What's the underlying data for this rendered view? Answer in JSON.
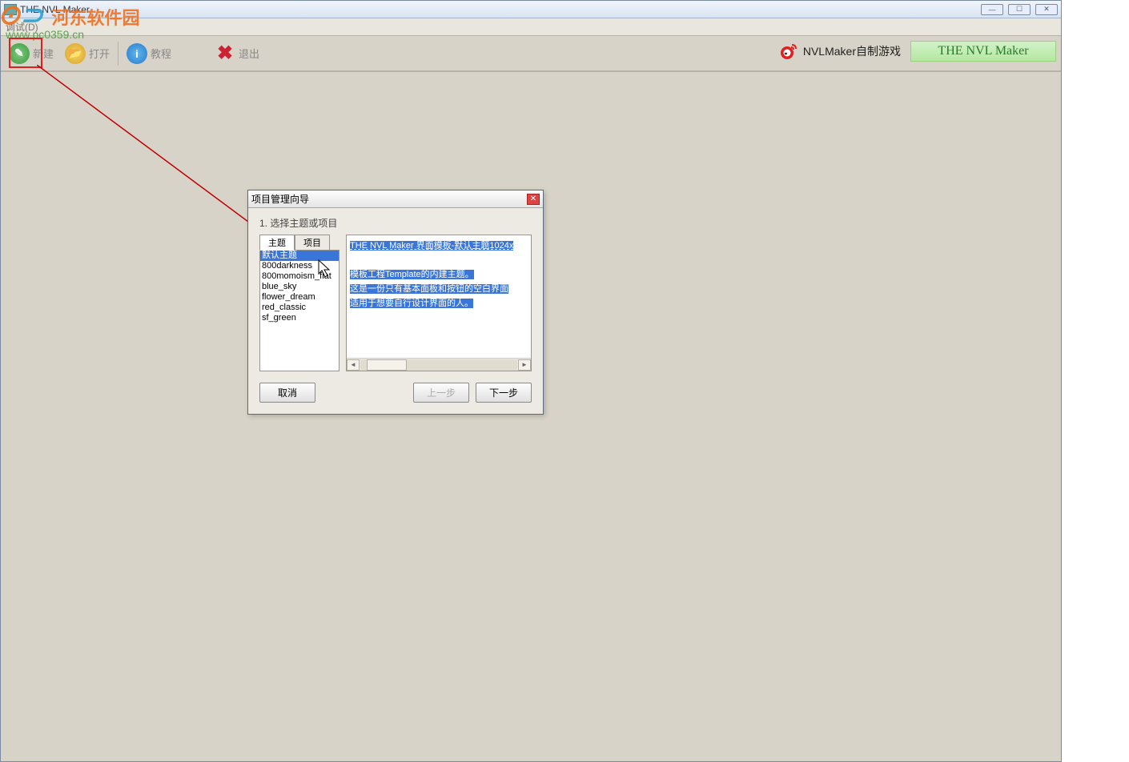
{
  "window": {
    "title": "THE NVL Maker"
  },
  "menu": {
    "debug": "调试(D)"
  },
  "toolbar": {
    "new": {
      "label": "新建"
    },
    "open": {
      "label": "打开"
    },
    "tutorial": {
      "label": "教程"
    },
    "exit": {
      "label": "退出"
    }
  },
  "brand": {
    "weibo": "NVLMaker自制游戏",
    "banner": "THE NVL Maker"
  },
  "watermark": {
    "logo_text": "河东软件园",
    "url": "www.pc0359.cn"
  },
  "dialog": {
    "title": "项目管理向导",
    "step": "1. 选择主题或项目",
    "tabs": {
      "theme": "主题",
      "project": "项目"
    },
    "themes": [
      "默认主题",
      "800darkness",
      "800momoism_flat",
      "blue_sky",
      "flower_dream",
      "red_classic",
      "sf_green"
    ],
    "desc": {
      "line1": "THE NVL Maker 界面模板-默认主题1024x",
      "line2": "模板工程Template的内建主题。",
      "line3": "这是一份只有基本面板和按钮的空白界面",
      "line4": "适用于想要自行设计界面的人。"
    },
    "btns": {
      "cancel": "取消",
      "prev": "上一步",
      "next": "下一步"
    }
  }
}
